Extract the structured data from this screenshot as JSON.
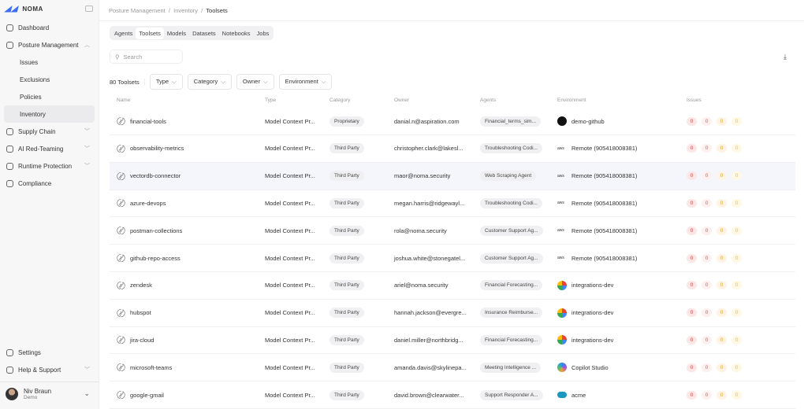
{
  "brand": "NOMA",
  "sidebar": {
    "items": [
      {
        "label": "Dashboard",
        "icon": "dashboard-icon"
      },
      {
        "label": "Posture Management",
        "icon": "shield-icon",
        "chev": "^"
      },
      {
        "label": "Issues",
        "sub": true
      },
      {
        "label": "Exclusions",
        "sub": true
      },
      {
        "label": "Policies",
        "sub": true
      },
      {
        "label": "Inventory",
        "sub": true,
        "active": true
      },
      {
        "label": "Supply Chain",
        "icon": "supply-chain-icon",
        "chev": "v"
      },
      {
        "label": "AI Red-Teaming",
        "icon": "red-team-icon",
        "chev": "v"
      },
      {
        "label": "Runtime Protection",
        "icon": "runtime-icon",
        "chev": "v"
      },
      {
        "label": "Compliance",
        "icon": "compliance-icon"
      }
    ],
    "bottom": [
      {
        "label": "Settings"
      },
      {
        "label": "Help & Support",
        "chev": "v"
      }
    ],
    "user": {
      "name": "Niv Braun",
      "org": "Demo"
    }
  },
  "breadcrumb": [
    "Posture Management",
    "Inventory",
    "Toolsets"
  ],
  "tabs": [
    "Agents",
    "Toolsets",
    "Models",
    "Datasets",
    "Notebooks",
    "Jobs"
  ],
  "active_tab": "Toolsets",
  "search": {
    "placeholder": "Search"
  },
  "filters": {
    "count": "80 Toolsets",
    "items": [
      "Type",
      "Category",
      "Owner",
      "Environment"
    ]
  },
  "columns": [
    "Name",
    "Type",
    "Category",
    "Owner",
    "Agents",
    "Environment",
    "Issues"
  ],
  "colors": {
    "critical": "#d64545",
    "high": "#e05a4a",
    "medium": "#e0a030",
    "low": "#e8c040"
  },
  "rows": [
    {
      "name": "financial-tools",
      "type": "Model Context Pr...",
      "category": "Proprietary",
      "owner": "danial.n@aspiration.com",
      "agent": "Financial_terms_sim...",
      "env_icon": "github",
      "env": "demo-github",
      "issues": [
        "0",
        "0",
        "0",
        "0"
      ]
    },
    {
      "name": "observability-metrics",
      "type": "Model Context Pr...",
      "category": "Third Party",
      "owner": "christopher.clark@lakesl...",
      "agent": "Troubleshooting Codi...",
      "env_icon": "aws",
      "env": "Remote (905418008381)",
      "issues": [
        "0",
        "0",
        "0",
        "0"
      ]
    },
    {
      "name": "vectordb-connector",
      "type": "Model Context Pr...",
      "category": "Third Party",
      "owner": "maor@noma.security",
      "agent": "Web Scraping Agent",
      "env_icon": "aws",
      "env": "Remote (905418008381)",
      "issues": [
        "0",
        "0",
        "0",
        "0"
      ]
    },
    {
      "name": "azure-devops",
      "type": "Model Context Pr...",
      "category": "Third Party",
      "owner": "megan.harris@ridgewayl...",
      "agent": "Troubleshooting Codi...",
      "env_icon": "aws",
      "env": "Remote (905418008381)",
      "issues": [
        "0",
        "0",
        "0",
        "0"
      ]
    },
    {
      "name": "postman-collections",
      "type": "Model Context Pr...",
      "category": "Third Party",
      "owner": "rola@noma.security",
      "agent": "Customer Support Ag...",
      "env_icon": "aws",
      "env": "Remote (905418008381)",
      "issues": [
        "0",
        "0",
        "0",
        "0"
      ]
    },
    {
      "name": "github-repo-access",
      "type": "Model Context Pr...",
      "category": "Third Party",
      "owner": "joshua.white@stonegatel...",
      "agent": "Customer Support Ag...",
      "env_icon": "aws",
      "env": "Remote (905418008381)",
      "issues": [
        "0",
        "0",
        "0",
        "0"
      ]
    },
    {
      "name": "zendesk",
      "type": "Model Context Pr...",
      "category": "Third Party",
      "owner": "ariel@noma.security",
      "agent": "Financial Forecasting...",
      "env_icon": "gcp",
      "env": "integrations-dev",
      "issues": [
        "0",
        "0",
        "0",
        "0"
      ]
    },
    {
      "name": "hubspot",
      "type": "Model Context Pr...",
      "category": "Third Party",
      "owner": "hannah.jackson@evergre...",
      "agent": "Insurance Reimburse...",
      "env_icon": "gcp",
      "env": "integrations-dev",
      "issues": [
        "0",
        "0",
        "0",
        "0"
      ]
    },
    {
      "name": "jira-cloud",
      "type": "Model Context Pr...",
      "category": "Third Party",
      "owner": "daniel.miller@northbridg...",
      "agent": "Financial Forecasting...",
      "env_icon": "gcp",
      "env": "integrations-dev",
      "issues": [
        "0",
        "0",
        "0",
        "0"
      ]
    },
    {
      "name": "microsoft-teams",
      "type": "Model Context Pr...",
      "category": "Third Party",
      "owner": "amanda.davis@skylinepa...",
      "agent": "Meeting Intelligence ...",
      "env_icon": "copilot",
      "env": "Copilot Studio",
      "issues": [
        "0",
        "0",
        "0",
        "0"
      ]
    },
    {
      "name": "google-gmail",
      "type": "Model Context Pr...",
      "category": "Third Party",
      "owner": "david.brown@clearwater...",
      "agent": "Support Responder A...",
      "env_icon": "salesforce",
      "env": "acme",
      "issues": [
        "0",
        "0",
        "0",
        "0"
      ]
    }
  ]
}
